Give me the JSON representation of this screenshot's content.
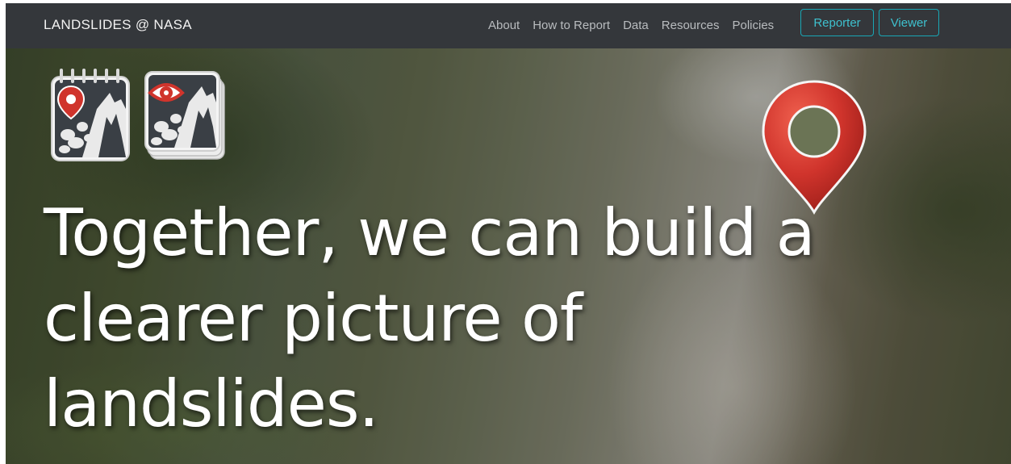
{
  "navbar": {
    "brand": "LANDSLIDES @ NASA",
    "links": [
      "About",
      "How to Report",
      "Data",
      "Resources",
      "Policies"
    ],
    "buttons": {
      "reporter": "Reporter",
      "viewer": "Viewer"
    }
  },
  "hero": {
    "headline": "Together, we can build a clearer picture of landslides."
  },
  "icons": {
    "reporter_app": "landslide-reporter-app-icon",
    "viewer_app": "landslide-viewer-app-icon",
    "map_pin": "map-pin-icon"
  },
  "colors": {
    "navbar_bg": "#34373b",
    "accent": "#19a7b5",
    "pin_red": "#d0342c"
  }
}
